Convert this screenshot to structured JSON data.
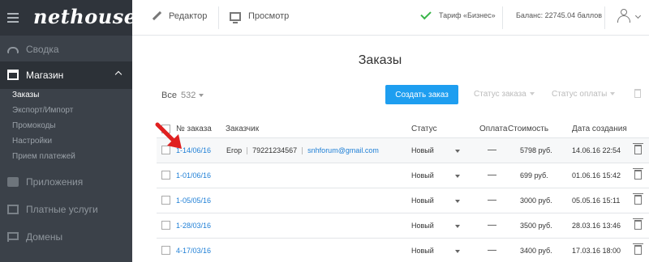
{
  "sidebar": {
    "logo": "nethouse",
    "items": [
      {
        "label": "Сводка",
        "icon": "dashboard-icon"
      },
      {
        "label": "Магазин",
        "icon": "shop-icon"
      },
      {
        "label": "Приложения",
        "icon": "puzzle-icon"
      },
      {
        "label": "Платные услуги",
        "icon": "card-icon"
      },
      {
        "label": "Домены",
        "icon": "flag-icon"
      }
    ],
    "shop_sub": [
      "Заказы",
      "Экспорт/Импорт",
      "Промокоды",
      "Настройки",
      "Прием платежей"
    ]
  },
  "topbar": {
    "editor": "Редактор",
    "preview": "Просмотр",
    "tariff": "Тариф «Бизнес»",
    "balance": "Баланс: 22745.04 баллов"
  },
  "main": {
    "title": "Заказы",
    "filter_all": "Все",
    "filter_count": "532",
    "create_button": "Создать заказ",
    "order_status_filter": "Статус заказа",
    "payment_status_filter": "Статус оплаты"
  },
  "table": {
    "headers": [
      "№ заказа",
      "Заказчик",
      "Статус",
      "Оплата",
      "Стоимость",
      "Дата создания"
    ],
    "rows": [
      {
        "order": "1-14/06/16",
        "name": "Егор",
        "phone": "79221234567",
        "email": "snhforum@gmail.com",
        "status": "Новый",
        "payment": "—",
        "cost": "5798 руб.",
        "date": "14.06.16 22:54"
      },
      {
        "order": "1-01/06/16",
        "name": "",
        "phone": "",
        "email": "",
        "status": "Новый",
        "payment": "—",
        "cost": "699 руб.",
        "date": "01.06.16 15:42"
      },
      {
        "order": "1-05/05/16",
        "name": "",
        "phone": "",
        "email": "",
        "status": "Новый",
        "payment": "—",
        "cost": "3000 руб.",
        "date": "05.05.16 15:11"
      },
      {
        "order": "1-28/03/16",
        "name": "",
        "phone": "",
        "email": "",
        "status": "Новый",
        "payment": "—",
        "cost": "3500 руб.",
        "date": "28.03.16 13:46"
      },
      {
        "order": "4-17/03/16",
        "name": "",
        "phone": "",
        "email": "",
        "status": "Новый",
        "payment": "—",
        "cost": "3400 руб.",
        "date": "17.03.16 18:00"
      }
    ]
  },
  "colors": {
    "accent": "#1e9ef0",
    "sidebar": "#3b4149",
    "arrow": "#e02020",
    "ok": "#3ab54a"
  }
}
